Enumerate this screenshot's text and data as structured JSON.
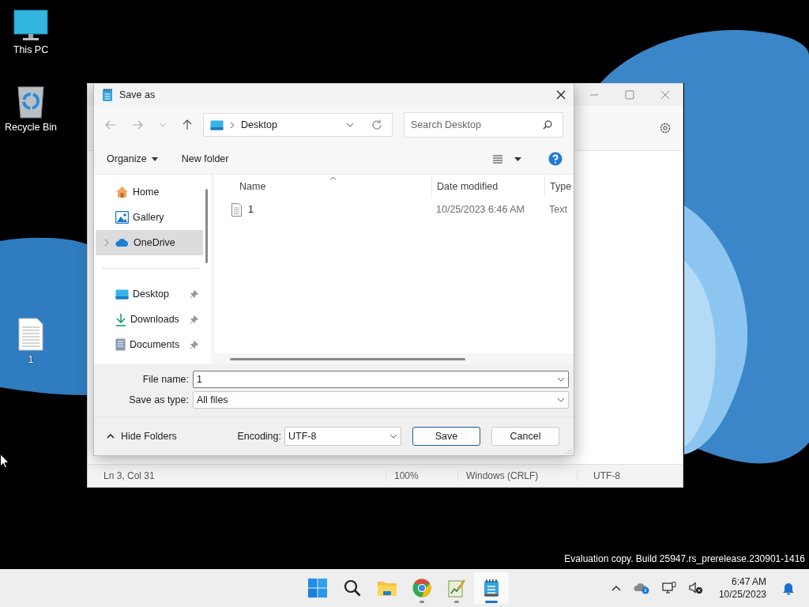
{
  "desktop_icons": [
    {
      "label": "This PC",
      "kind": "pc"
    },
    {
      "label": "Recycle Bin",
      "kind": "bin"
    },
    {
      "label": "1",
      "kind": "file"
    }
  ],
  "notepad": {
    "status_bar": [
      "Ln 3, Col 31",
      "100%",
      "Windows (CRLF)",
      "UTF-8"
    ]
  },
  "dialog": {
    "title": "Save as",
    "address": "Desktop",
    "search_placeholder": "Search Desktop",
    "toolbar": [
      "Organize",
      "New folder"
    ],
    "nav_sections": [
      {
        "items": [
          {
            "label": "Home",
            "kind": "home",
            "selected": false,
            "expandable": false,
            "pinned": false
          },
          {
            "label": "Gallery",
            "kind": "gallery",
            "selected": false,
            "expandable": false,
            "pinned": false
          },
          {
            "label": "OneDrive",
            "kind": "cloud",
            "selected": true,
            "expandable": true,
            "pinned": false
          }
        ]
      },
      {
        "items": [
          {
            "label": "Desktop",
            "kind": "desktop",
            "selected": false,
            "expandable": false,
            "pinned": true
          },
          {
            "label": "Downloads",
            "kind": "download",
            "selected": false,
            "expandable": false,
            "pinned": true
          },
          {
            "label": "Documents",
            "kind": "documents",
            "selected": false,
            "expandable": false,
            "pinned": true
          }
        ]
      }
    ],
    "columns": [
      "Name",
      "Date modified",
      "Type"
    ],
    "rows": [
      {
        "name": "1",
        "date": "10/25/2023 6:46 AM",
        "type": "Text"
      }
    ],
    "file_name_label": "File name:",
    "file_name": "1",
    "save_type_label": "Save as type:",
    "save_type": "All files",
    "hide_folders": "Hide Folders",
    "encoding_label": "Encoding:",
    "encoding": "UTF-8",
    "buttons": [
      {
        "label": "Save",
        "kind": "default"
      },
      {
        "label": "Cancel",
        "kind": "normal"
      }
    ]
  },
  "watermark": "Evaluation copy. Build 25947.rs_prerelease.230901-1416",
  "taskbar": {
    "apps": [
      {
        "kind": "start",
        "running": false,
        "selected": false
      },
      {
        "kind": "search",
        "running": false,
        "selected": false
      },
      {
        "kind": "explorer",
        "running": false,
        "selected": false
      },
      {
        "kind": "chrome",
        "running": true,
        "selected": false
      },
      {
        "kind": "editor",
        "running": true,
        "selected": false
      },
      {
        "kind": "notepad",
        "running": true,
        "selected": true
      }
    ],
    "time": "6:47 AM",
    "date": "10/25/2023"
  }
}
